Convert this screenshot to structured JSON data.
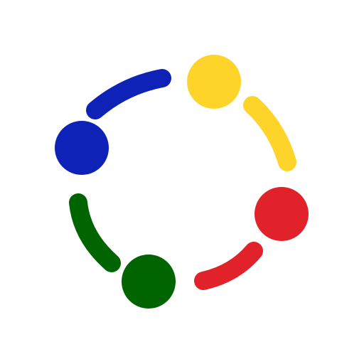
{
  "logo": {
    "name": "circular-people-logo",
    "colors": {
      "blue": "#0f22b8",
      "yellow": "#ffd42a",
      "red": "#e2222a",
      "green": "#006400"
    }
  }
}
